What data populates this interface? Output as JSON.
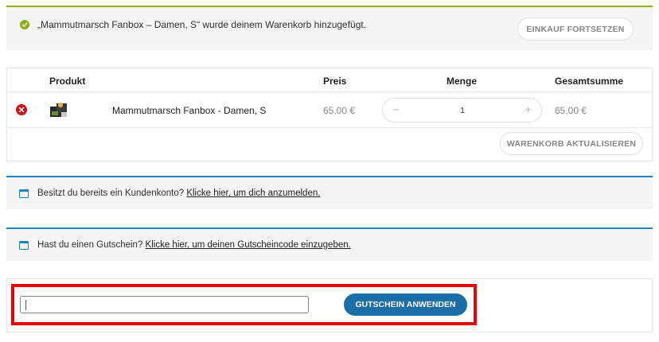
{
  "success_notice": {
    "message": "„Mammutmarsch Fanbox – Damen, S“ wurde deinem Warenkorb hinzugefügt.",
    "continue_label": "Einkauf fortsetzen",
    "accent": "#8fae1b"
  },
  "cart": {
    "headers": {
      "product": "Produkt",
      "price": "Preis",
      "quantity": "Menge",
      "total": "Gesamtsumme"
    },
    "items": [
      {
        "name": "Mammutmarsch Fanbox - Damen, S",
        "price": "65,00 €",
        "quantity": "1",
        "total": "65,00 €"
      }
    ],
    "update_label": "Warenkorb aktualisieren"
  },
  "login_notice": {
    "text": "Besitzt du bereits ein Kundenkonto?",
    "link": "Klicke hier, um dich anzumelden."
  },
  "coupon_notice": {
    "text": "Hast du einen Gutschein?",
    "link": "Klicke hier, um deinen Gutscheincode einzugeben."
  },
  "coupon_form": {
    "input_value": "",
    "apply_label": "Gutschein anwenden",
    "highlight_color": "#e8000b",
    "button_color": "#1b6fa8"
  },
  "colors": {
    "info_accent": "#1e85be",
    "remove": "#c4161c"
  },
  "icons": {
    "success": "check-circle-icon",
    "remove": "remove-circle-icon",
    "info": "window-icon",
    "minus": "minus-icon",
    "plus": "plus-icon"
  }
}
